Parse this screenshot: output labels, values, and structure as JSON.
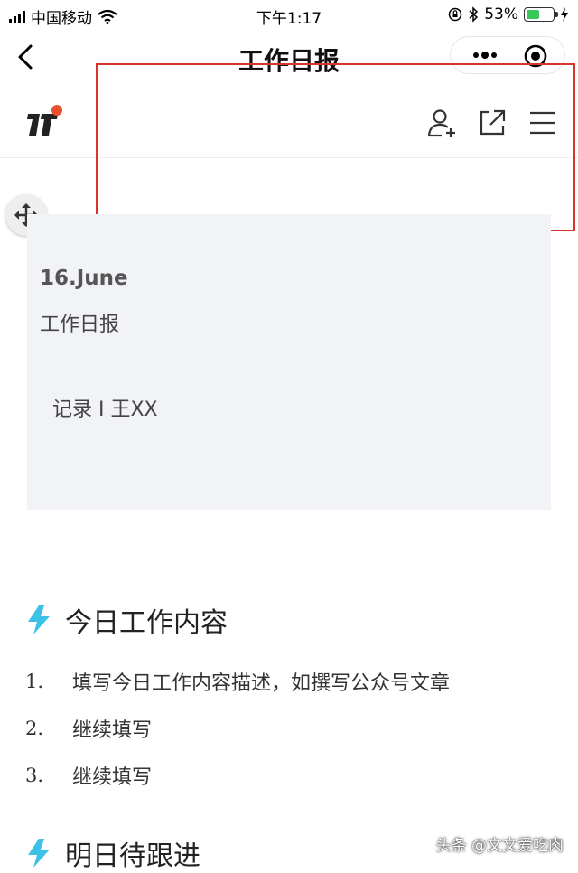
{
  "status_bar": {
    "carrier": "中国移动",
    "time": "下午1:17",
    "battery": "53%",
    "battery_level": 0.53
  },
  "nav": {
    "title": "工作日报"
  },
  "card": {
    "date": "16.June",
    "title": "工作日报",
    "recorder": "记录 I 王XX"
  },
  "section1": {
    "heading": "今日工作内容",
    "items": [
      {
        "num": "1.",
        "text": "填写今日工作内容描述，如撰写公众号文章"
      },
      {
        "num": "2.",
        "text": "继续填写"
      },
      {
        "num": "3.",
        "text": "继续填写"
      }
    ]
  },
  "section2": {
    "heading": "明日待跟进"
  },
  "watermark": "头条 @文文爱吃肉",
  "colors": {
    "accent_bolt": "#3cc2e8",
    "highlight_border": "#d9342b",
    "card_bg": "#f1f3f7",
    "logo_dot": "#e8502e",
    "battery_fill": "#3bc65a"
  },
  "icons": {
    "back": "chevron-left-icon",
    "more": "more-dots-icon",
    "close": "target-circle-icon",
    "add_member": "add-user-icon",
    "share": "external-link-icon",
    "menu": "hamburger-menu-icon",
    "move": "move-arrows-icon",
    "section": "lightning-bolt-icon"
  }
}
